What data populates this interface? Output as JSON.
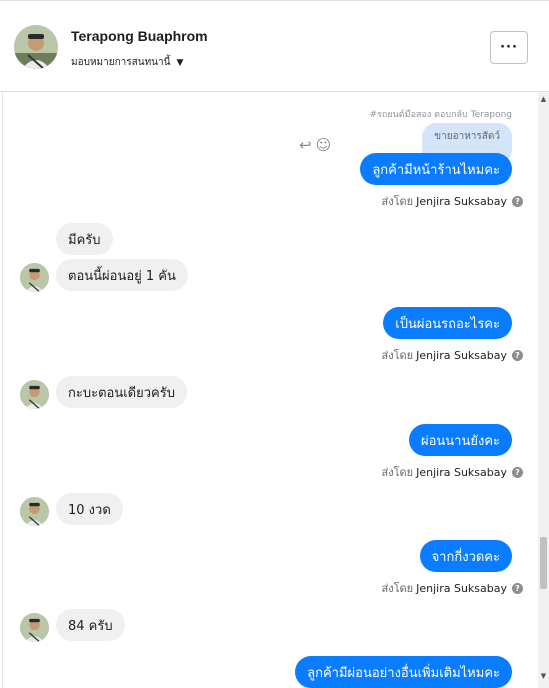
{
  "contact": {
    "name": "Terapong Buaphrom",
    "assign_label": "มอบหมายการสนทนานี้",
    "more_label": "···"
  },
  "reply": {
    "caption": "#รถยนต์มือสอง ตอบกลับ Terapong",
    "quoted": "ขายอาหารสัตว์",
    "icons": [
      "reply-icon",
      "emoji-icon"
    ]
  },
  "sent_by_prefix": "ส่งโดย",
  "agent_name": "Jenjira Suksabay",
  "messages": {
    "m1": "ลูกค้ามีหน้าร้านไหมคะ",
    "m2": "มีครับ",
    "m3": "ตอนนี้ผ่อนอยู่ 1 คัน",
    "m4": "เป็นผ่อนรถอะไรคะ",
    "m5": "กะบะตอนเดียวครับ",
    "m6": "ผ่อนนานยังคะ",
    "m7": "10 งวด",
    "m8": "จากกี่งวดคะ",
    "m9": "84 ครับ",
    "m10": "ลูกค้ามีผ่อนอย่างอื่นเพิ่มเติมไหมคะ"
  },
  "colors": {
    "outgoing_bubble": "#0a7cff",
    "incoming_bubble": "#f0f0f0",
    "reply_quote": "#d4e4fb"
  }
}
